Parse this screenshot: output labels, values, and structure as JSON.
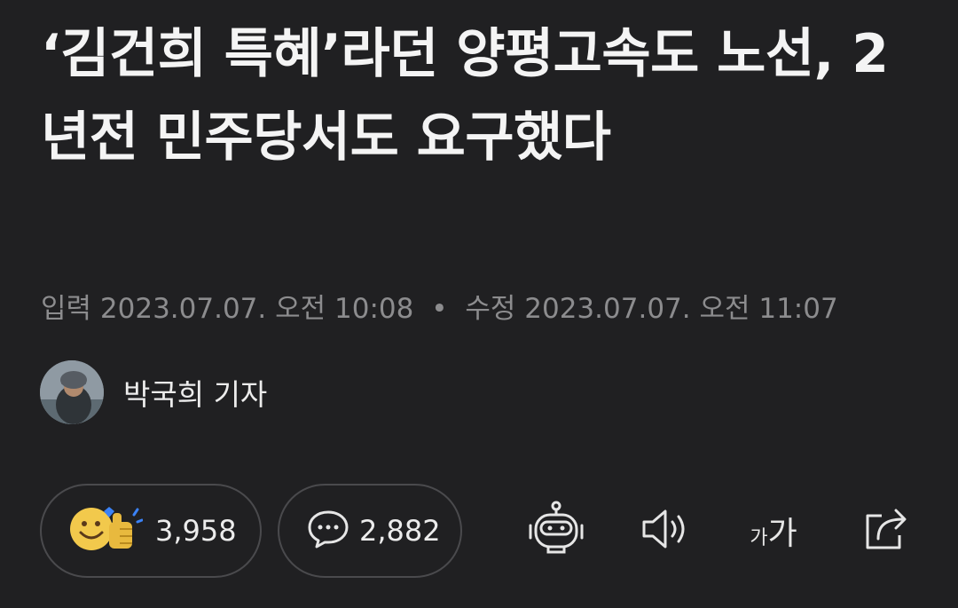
{
  "article": {
    "headline": "‘김건희 특혜’라던 양평고속도 노선, 2년전 민주당서도 요구했다",
    "input_label": "입력",
    "input_datetime": "2023.07.07. 오전 10:08",
    "separator": "•",
    "modified_label": "수정",
    "modified_datetime": "2023.07.07. 오전 11:07",
    "author": "박국희 기자"
  },
  "actions": {
    "like_count": "3,958",
    "comment_count": "2,882",
    "font_small": "가",
    "font_big": "가"
  },
  "icons": {
    "like": "smiley-thumbs-up-icon",
    "comment": "speech-bubble-icon",
    "summary": "robot-icon",
    "listen": "speaker-icon",
    "font": "font-size-icon",
    "share": "share-icon"
  },
  "colors": {
    "background": "#202022",
    "headline": "#f4f4f4",
    "meta": "#8c8c8e",
    "pill_border": "#4a4a4d",
    "emoji_yellow": "#f2c94c",
    "heart_blue": "#3b82f6"
  }
}
